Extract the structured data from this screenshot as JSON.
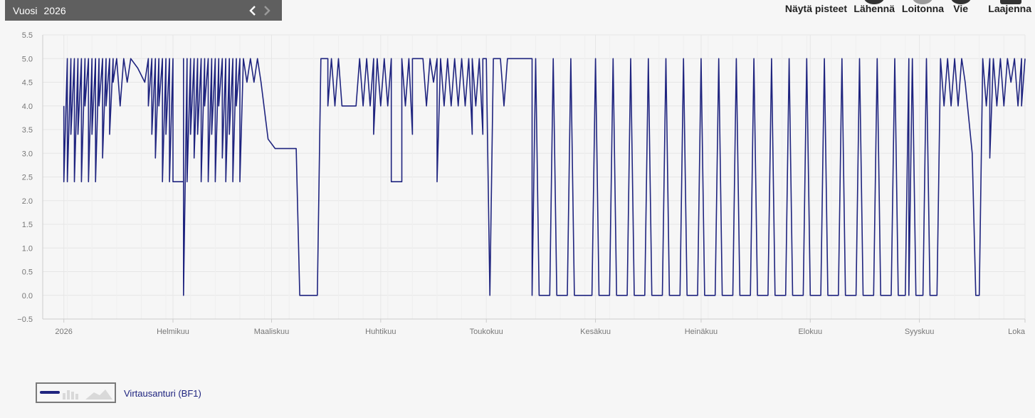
{
  "period": {
    "label": "Vuosi",
    "year": "2026",
    "prev_icon": "‹",
    "next_icon": "›"
  },
  "toolbar": {
    "show_points": "Näytä pisteet",
    "zoom_in": "Lähennä",
    "zoom_out": "Loitonna",
    "export": "Vie",
    "expand": "Laajenna"
  },
  "colors": {
    "series": "#1f247f",
    "grid": "#e6e6e6",
    "axis": "#cccccc",
    "bar": "#5f5f5f"
  },
  "chart_data": {
    "type": "line",
    "title": "",
    "xlabel": "",
    "ylabel": "",
    "ylim": [
      -0.5,
      5.5
    ],
    "yticks": [
      "5.5",
      "5.0",
      "4.5",
      "4.0",
      "3.5",
      "3.0",
      "2.5",
      "2.0",
      "1.5",
      "1.0",
      "0.5",
      "0.0",
      "−0.5"
    ],
    "x_type": "date",
    "xlim": [
      "2025-12-26",
      "2026-10-01"
    ],
    "xticks": [
      {
        "label": "2026",
        "date": "2026-01-01"
      },
      {
        "label": "Helmikuu",
        "date": "2026-02-01"
      },
      {
        "label": "Maaliskuu",
        "date": "2026-03-01"
      },
      {
        "label": "Huhtikuu",
        "date": "2026-04-01"
      },
      {
        "label": "Toukokuu",
        "date": "2026-05-01"
      },
      {
        "label": "Kesäkuu",
        "date": "2026-06-01"
      },
      {
        "label": "Heinäkuu",
        "date": "2026-07-01"
      },
      {
        "label": "Elokuu",
        "date": "2026-08-01"
      },
      {
        "label": "Syyskuu",
        "date": "2026-09-01"
      },
      {
        "label": "Loka",
        "date": "2026-10-01"
      }
    ],
    "grid": true,
    "legend": "bottom-left",
    "series": [
      {
        "name": "Virtausanturi (BF1)",
        "points": [
          [
            "2026-01-01",
            4.0
          ],
          [
            "2026-01-01",
            2.4
          ],
          [
            "2026-01-02",
            5.0
          ],
          [
            "2026-01-02",
            2.4
          ],
          [
            "2026-01-03",
            5.0
          ],
          [
            "2026-01-03",
            3.4
          ],
          [
            "2026-01-04",
            5.0
          ],
          [
            "2026-01-04",
            2.4
          ],
          [
            "2026-01-05",
            5.0
          ],
          [
            "2026-01-05",
            3.4
          ],
          [
            "2026-01-06",
            5.0
          ],
          [
            "2026-01-06",
            2.4
          ],
          [
            "2026-01-07",
            5.0
          ],
          [
            "2026-01-07",
            4.0
          ],
          [
            "2026-01-08",
            5.0
          ],
          [
            "2026-01-08",
            2.4
          ],
          [
            "2026-01-09",
            5.0
          ],
          [
            "2026-01-09",
            3.4
          ],
          [
            "2026-01-10",
            5.0
          ],
          [
            "2026-01-10",
            2.4
          ],
          [
            "2026-01-11",
            5.0
          ],
          [
            "2026-01-11",
            4.0
          ],
          [
            "2026-01-12",
            5.0
          ],
          [
            "2026-01-12",
            2.9
          ],
          [
            "2026-01-13",
            5.0
          ],
          [
            "2026-01-13",
            4.0
          ],
          [
            "2026-01-14",
            5.0
          ],
          [
            "2026-01-14",
            3.4
          ],
          [
            "2026-01-15",
            5.0
          ],
          [
            "2026-01-15",
            4.5
          ],
          [
            "2026-01-16",
            5.0
          ],
          [
            "2026-01-17",
            4.0
          ],
          [
            "2026-01-18",
            5.0
          ],
          [
            "2026-01-19",
            4.5
          ],
          [
            "2026-01-20",
            5.0
          ],
          [
            "2026-01-22",
            4.8
          ],
          [
            "2026-01-24",
            4.5
          ],
          [
            "2026-01-25",
            5.0
          ],
          [
            "2026-01-25",
            4.0
          ],
          [
            "2026-01-26",
            5.0
          ],
          [
            "2026-01-26",
            3.4
          ],
          [
            "2026-01-27",
            5.0
          ],
          [
            "2026-01-27",
            2.9
          ],
          [
            "2026-01-28",
            5.0
          ],
          [
            "2026-01-28",
            4.0
          ],
          [
            "2026-01-29",
            5.0
          ],
          [
            "2026-01-29",
            2.4
          ],
          [
            "2026-01-30",
            5.0
          ],
          [
            "2026-01-30",
            3.4
          ],
          [
            "2026-01-31",
            5.0
          ],
          [
            "2026-01-31",
            2.4
          ],
          [
            "2026-02-01",
            5.0
          ],
          [
            "2026-02-01",
            2.4
          ],
          [
            "2026-02-04",
            2.4
          ],
          [
            "2026-02-04",
            5.0
          ],
          [
            "2026-02-04",
            0.0
          ],
          [
            "2026-02-05",
            5.0
          ],
          [
            "2026-02-05",
            2.4
          ],
          [
            "2026-02-06",
            5.0
          ],
          [
            "2026-02-06",
            3.4
          ],
          [
            "2026-02-07",
            5.0
          ],
          [
            "2026-02-07",
            2.9
          ],
          [
            "2026-02-08",
            5.0
          ],
          [
            "2026-02-08",
            3.4
          ],
          [
            "2026-02-09",
            5.0
          ],
          [
            "2026-02-09",
            2.4
          ],
          [
            "2026-02-10",
            5.0
          ],
          [
            "2026-02-10",
            4.0
          ],
          [
            "2026-02-11",
            5.0
          ],
          [
            "2026-02-11",
            2.4
          ],
          [
            "2026-02-12",
            5.0
          ],
          [
            "2026-02-12",
            3.4
          ],
          [
            "2026-02-13",
            5.0
          ],
          [
            "2026-02-13",
            2.4
          ],
          [
            "2026-02-14",
            5.0
          ],
          [
            "2026-02-14",
            4.0
          ],
          [
            "2026-02-15",
            5.0
          ],
          [
            "2026-02-15",
            2.9
          ],
          [
            "2026-02-16",
            5.0
          ],
          [
            "2026-02-16",
            2.4
          ],
          [
            "2026-02-17",
            5.0
          ],
          [
            "2026-02-17",
            3.4
          ],
          [
            "2026-02-18",
            5.0
          ],
          [
            "2026-02-18",
            2.4
          ],
          [
            "2026-02-19",
            5.0
          ],
          [
            "2026-02-19",
            4.0
          ],
          [
            "2026-02-20",
            5.0
          ],
          [
            "2026-02-20",
            2.4
          ],
          [
            "2026-02-21",
            5.0
          ],
          [
            "2026-02-22",
            4.5
          ],
          [
            "2026-02-23",
            5.0
          ],
          [
            "2026-02-24",
            4.5
          ],
          [
            "2026-02-25",
            5.0
          ],
          [
            "2026-02-26",
            4.5
          ],
          [
            "2026-02-28",
            3.3
          ],
          [
            "2026-03-02",
            3.1
          ],
          [
            "2026-03-07",
            3.1
          ],
          [
            "2026-03-08",
            3.1
          ],
          [
            "2026-03-09",
            0.0
          ],
          [
            "2026-03-14",
            0.0
          ],
          [
            "2026-03-15",
            5.0
          ],
          [
            "2026-03-17",
            5.0
          ],
          [
            "2026-03-17",
            4.0
          ],
          [
            "2026-03-18",
            5.0
          ],
          [
            "2026-03-19",
            4.0
          ],
          [
            "2026-03-20",
            5.0
          ],
          [
            "2026-03-21",
            4.0
          ],
          [
            "2026-03-25",
            4.0
          ],
          [
            "2026-03-26",
            5.0
          ],
          [
            "2026-03-27",
            4.0
          ],
          [
            "2026-03-28",
            5.0
          ],
          [
            "2026-03-29",
            4.0
          ],
          [
            "2026-03-30",
            5.0
          ],
          [
            "2026-03-30",
            3.4
          ],
          [
            "2026-03-31",
            5.0
          ],
          [
            "2026-04-01",
            4.0
          ],
          [
            "2026-04-02",
            5.0
          ],
          [
            "2026-04-03",
            4.0
          ],
          [
            "2026-04-04",
            5.0
          ],
          [
            "2026-04-04",
            2.4
          ],
          [
            "2026-04-07",
            2.4
          ],
          [
            "2026-04-07",
            5.0
          ],
          [
            "2026-04-08",
            4.0
          ],
          [
            "2026-04-09",
            5.0
          ],
          [
            "2026-04-10",
            3.4
          ],
          [
            "2026-04-10",
            5.0
          ],
          [
            "2026-04-13",
            5.0
          ],
          [
            "2026-04-14",
            4.0
          ],
          [
            "2026-04-15",
            5.0
          ],
          [
            "2026-04-16",
            4.5
          ],
          [
            "2026-04-17",
            5.0
          ],
          [
            "2026-04-17",
            2.4
          ],
          [
            "2026-04-18",
            5.0
          ],
          [
            "2026-04-19",
            4.0
          ],
          [
            "2026-04-20",
            5.0
          ],
          [
            "2026-04-21",
            4.0
          ],
          [
            "2026-04-22",
            5.0
          ],
          [
            "2026-04-23",
            4.0
          ],
          [
            "2026-04-24",
            5.0
          ],
          [
            "2026-04-25",
            4.0
          ],
          [
            "2026-04-26",
            5.0
          ],
          [
            "2026-04-27",
            3.4
          ],
          [
            "2026-04-27",
            5.0
          ],
          [
            "2026-04-28",
            4.0
          ],
          [
            "2026-04-29",
            5.0
          ],
          [
            "2026-04-30",
            3.4
          ],
          [
            "2026-04-30",
            5.0
          ],
          [
            "2026-05-01",
            5.0
          ],
          [
            "2026-05-02",
            0.0
          ],
          [
            "2026-05-03",
            5.0
          ],
          [
            "2026-05-05",
            5.0
          ],
          [
            "2026-05-06",
            4.0
          ],
          [
            "2026-05-07",
            5.0
          ],
          [
            "2026-05-14",
            5.0
          ],
          [
            "2026-05-14",
            0.0
          ],
          [
            "2026-05-15",
            5.0
          ],
          [
            "2026-05-16",
            0.0
          ],
          [
            "2026-05-19",
            0.0
          ],
          [
            "2026-05-20",
            5.0
          ],
          [
            "2026-05-21",
            0.0
          ],
          [
            "2026-05-24",
            0.0
          ],
          [
            "2026-05-25",
            5.0
          ],
          [
            "2026-05-26",
            0.0
          ],
          [
            "2026-05-31",
            0.0
          ],
          [
            "2026-06-01",
            5.0
          ],
          [
            "2026-06-02",
            0.0
          ],
          [
            "2026-06-05",
            0.0
          ],
          [
            "2026-06-06",
            5.0
          ],
          [
            "2026-06-07",
            0.0
          ],
          [
            "2026-06-10",
            0.0
          ],
          [
            "2026-06-11",
            5.0
          ],
          [
            "2026-06-12",
            0.0
          ],
          [
            "2026-06-15",
            0.0
          ],
          [
            "2026-06-16",
            5.0
          ],
          [
            "2026-06-17",
            0.0
          ],
          [
            "2026-06-20",
            0.0
          ],
          [
            "2026-06-21",
            5.0
          ],
          [
            "2026-06-22",
            0.0
          ],
          [
            "2026-06-25",
            0.0
          ],
          [
            "2026-06-26",
            5.0
          ],
          [
            "2026-06-27",
            0.0
          ],
          [
            "2026-06-30",
            0.0
          ],
          [
            "2026-07-01",
            5.0
          ],
          [
            "2026-07-02",
            0.0
          ],
          [
            "2026-07-05",
            0.0
          ],
          [
            "2026-07-06",
            5.0
          ],
          [
            "2026-07-07",
            0.0
          ],
          [
            "2026-07-10",
            0.0
          ],
          [
            "2026-07-11",
            5.0
          ],
          [
            "2026-07-12",
            0.0
          ],
          [
            "2026-07-15",
            0.0
          ],
          [
            "2026-07-16",
            5.0
          ],
          [
            "2026-07-17",
            0.0
          ],
          [
            "2026-07-20",
            0.0
          ],
          [
            "2026-07-21",
            5.0
          ],
          [
            "2026-07-22",
            0.0
          ],
          [
            "2026-07-25",
            0.0
          ],
          [
            "2026-07-26",
            5.0
          ],
          [
            "2026-07-27",
            0.0
          ],
          [
            "2026-07-30",
            0.0
          ],
          [
            "2026-07-31",
            5.0
          ],
          [
            "2026-08-01",
            0.0
          ],
          [
            "2026-08-04",
            0.0
          ],
          [
            "2026-08-05",
            5.0
          ],
          [
            "2026-08-06",
            0.0
          ],
          [
            "2026-08-09",
            0.0
          ],
          [
            "2026-08-10",
            5.0
          ],
          [
            "2026-08-11",
            0.0
          ],
          [
            "2026-08-14",
            0.0
          ],
          [
            "2026-08-15",
            5.0
          ],
          [
            "2026-08-16",
            0.0
          ],
          [
            "2026-08-19",
            0.0
          ],
          [
            "2026-08-20",
            5.0
          ],
          [
            "2026-08-21",
            0.0
          ],
          [
            "2026-08-24",
            0.0
          ],
          [
            "2026-08-25",
            5.0
          ],
          [
            "2026-08-26",
            0.0
          ],
          [
            "2026-08-28",
            0.0
          ],
          [
            "2026-08-29",
            5.0
          ],
          [
            "2026-08-29",
            0.0
          ],
          [
            "2026-08-30",
            5.0
          ],
          [
            "2026-08-31",
            0.0
          ],
          [
            "2026-09-02",
            0.0
          ],
          [
            "2026-09-03",
            5.0
          ],
          [
            "2026-09-04",
            0.0
          ],
          [
            "2026-09-06",
            0.0
          ],
          [
            "2026-09-07",
            5.0
          ],
          [
            "2026-09-08",
            4.0
          ],
          [
            "2026-09-09",
            5.0
          ],
          [
            "2026-09-10",
            4.0
          ],
          [
            "2026-09-11",
            5.0
          ],
          [
            "2026-09-12",
            4.0
          ],
          [
            "2026-09-13",
            5.0
          ],
          [
            "2026-09-14",
            4.5
          ],
          [
            "2026-09-16",
            3.0
          ],
          [
            "2026-09-17",
            0.0
          ],
          [
            "2026-09-18",
            0.0
          ],
          [
            "2026-09-19",
            5.0
          ],
          [
            "2026-09-20",
            4.0
          ],
          [
            "2026-09-21",
            5.0
          ],
          [
            "2026-09-21",
            2.9
          ],
          [
            "2026-09-22",
            5.0
          ],
          [
            "2026-09-23",
            4.0
          ],
          [
            "2026-09-24",
            5.0
          ],
          [
            "2026-09-25",
            4.0
          ],
          [
            "2026-09-26",
            5.0
          ],
          [
            "2026-09-27",
            4.5
          ],
          [
            "2026-09-28",
            5.0
          ],
          [
            "2026-09-29",
            4.0
          ],
          [
            "2026-09-30",
            5.0
          ],
          [
            "2026-09-30",
            4.0
          ],
          [
            "2026-10-01",
            5.0
          ]
        ]
      }
    ]
  }
}
